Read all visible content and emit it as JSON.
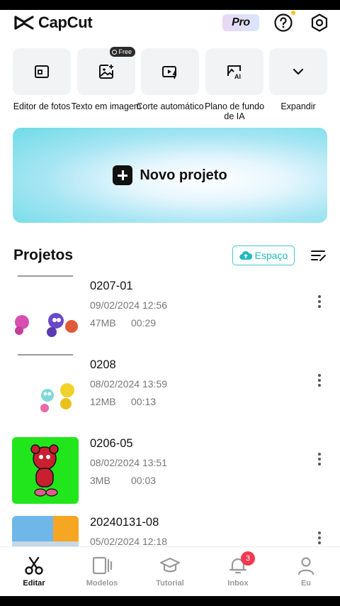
{
  "app": {
    "name": "CapCut",
    "pro_label": "Pro"
  },
  "tools": [
    {
      "label": "Editor de fotos",
      "icon": "photo-editor-icon"
    },
    {
      "label": "Texto em imagem",
      "icon": "text-to-image-icon",
      "badge": "Free"
    },
    {
      "label": "Corte automático",
      "icon": "auto-cut-icon"
    },
    {
      "label": "Plano de fundo de IA",
      "icon": "ai-background-icon"
    },
    {
      "label": "Expandir",
      "icon": "chevron-down-icon"
    }
  ],
  "banner": {
    "label": "Novo projeto"
  },
  "projects_section": {
    "title": "Projetos",
    "space_label": "Espaço"
  },
  "projects": [
    {
      "name": "0207-01",
      "date": "09/02/2024 12:56",
      "size": "47MB",
      "duration": "00:29"
    },
    {
      "name": "0208",
      "date": "08/02/2024 13:59",
      "size": "12MB",
      "duration": "00:13"
    },
    {
      "name": "0206-05",
      "date": "08/02/2024 13:51",
      "size": "3MB",
      "duration": "00:03"
    },
    {
      "name": "20240131-08",
      "date": "05/02/2024 12:18",
      "size": "",
      "duration": ""
    }
  ],
  "nav": [
    {
      "label": "Editar",
      "active": true
    },
    {
      "label": "Modelos"
    },
    {
      "label": "Tutorial"
    },
    {
      "label": "Inbox",
      "badge": "3"
    },
    {
      "label": "Eu"
    }
  ],
  "colors": {
    "accent": "#22b9c1",
    "badge_red": "#f03a52",
    "thumb_green": "#22e61c"
  }
}
